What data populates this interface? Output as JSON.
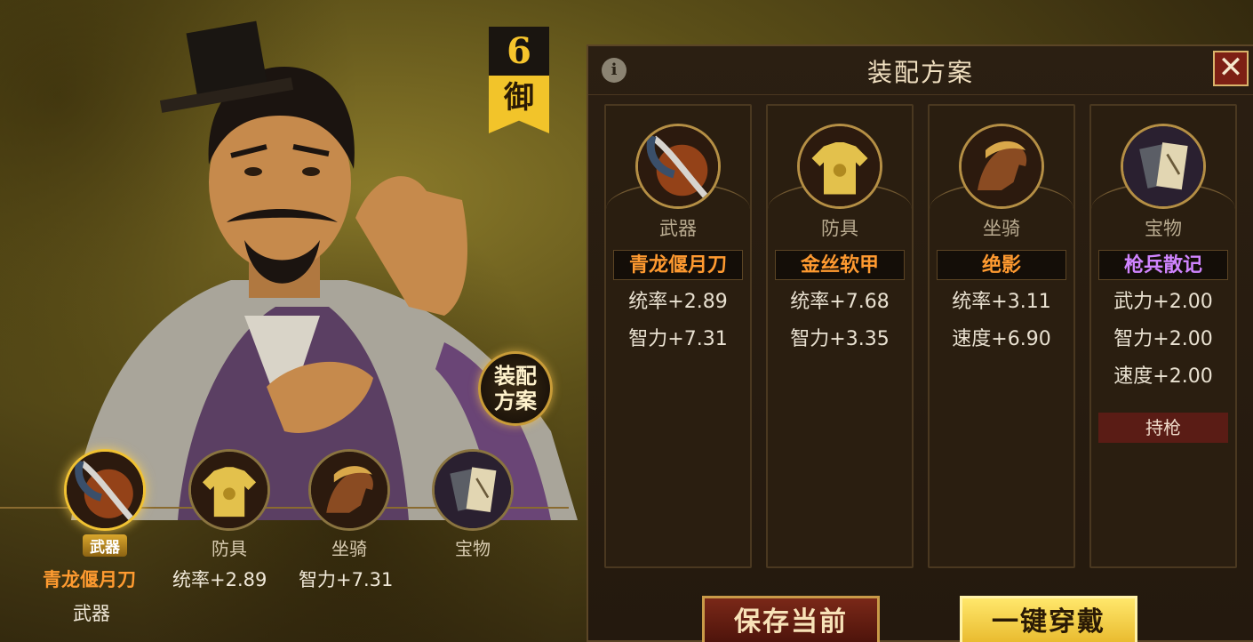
{
  "hero": {
    "rank_number": "6",
    "rank_label": "御",
    "loadout_button_label": "装配方案",
    "slots": [
      {
        "label": "武器",
        "active": true
      },
      {
        "label": "防具",
        "active": false
      },
      {
        "label": "坐骑",
        "active": false
      },
      {
        "label": "宝物",
        "active": false
      }
    ],
    "selected_item_name": "青龙偃月刀",
    "selected_item_stat_1": "统率+2.89",
    "selected_item_stat_2": "智力+7.31",
    "selected_item_type": "武器"
  },
  "panel": {
    "title": "装配方案",
    "info_icon": "i",
    "close_label": "✕",
    "cards": [
      {
        "slot": "武器",
        "name": "青龙偃月刀",
        "name_color": "orange",
        "stats": [
          "统率+2.89",
          "智力+7.31"
        ],
        "tag": ""
      },
      {
        "slot": "防具",
        "name": "金丝软甲",
        "name_color": "orange",
        "stats": [
          "统率+7.68",
          "智力+3.35"
        ],
        "tag": ""
      },
      {
        "slot": "坐骑",
        "name": "绝影",
        "name_color": "orange",
        "stats": [
          "统率+3.11",
          "速度+6.90"
        ],
        "tag": ""
      },
      {
        "slot": "宝物",
        "name": "枪兵散记",
        "name_color": "purple",
        "stats": [
          "武力+2.00",
          "智力+2.00",
          "速度+2.00"
        ],
        "tag": "持枪"
      }
    ]
  },
  "buttons": {
    "save": "保存当前",
    "equip": "一键穿戴"
  },
  "colors": {
    "accent_gold": "#f1c232",
    "name_orange": "#ff9a30",
    "name_purple": "#d084ff",
    "tag_red": "#5a1c15"
  }
}
